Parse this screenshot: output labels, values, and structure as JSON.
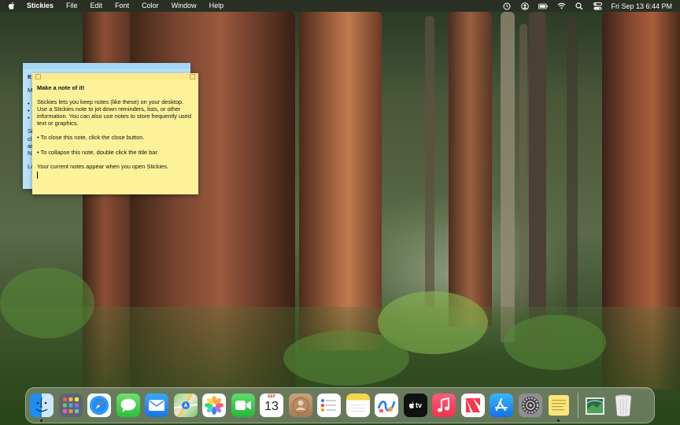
{
  "menubar": {
    "apple_icon": "apple-logo-icon",
    "app_name": "Stickies",
    "menus": [
      "File",
      "Edit",
      "Font",
      "Color",
      "Window",
      "Help"
    ],
    "status_icons": [
      "time-machine-icon",
      "user-icon",
      "battery-icon",
      "wifi-icon",
      "search-icon",
      "control-center-icon"
    ],
    "clock": "Fri Sep 13  6:44 PM"
  },
  "sticky_blue": {
    "color": "#b7e3fb",
    "line1": "It",
    "line2": "M",
    "line3": "•",
    "line4": "•",
    "line5": "•",
    "line6": "Si",
    "line7": "cl",
    "line8": "ar",
    "line9": "N",
    "line10": "Lo"
  },
  "sticky_yellow": {
    "color": "#fdf29a",
    "title": "Make a note of it!",
    "paragraph1": "Stickies lets you keep notes (like these) on your desktop. Use a Stickies note to jot down reminders, lists, or other information. You can also use notes to store frequently used text or graphics.",
    "bullet1": "• To close this note, click the close button.",
    "bullet2": "• To collapse this note, double click the title bar.",
    "paragraph2": "Your current notes appear when you open Stickies."
  },
  "dock": {
    "apps": [
      "finder",
      "launchpad",
      "safari",
      "messages",
      "mail",
      "maps",
      "photos",
      "facetime",
      "calendar",
      "contacts",
      "reminders",
      "notes",
      "freeform",
      "tv",
      "music",
      "news",
      "app-store",
      "system-settings",
      "stickies"
    ],
    "calendar_month": "SEP",
    "calendar_day": "13",
    "tv_label": "tv",
    "right": [
      "downloads",
      "trash"
    ]
  }
}
